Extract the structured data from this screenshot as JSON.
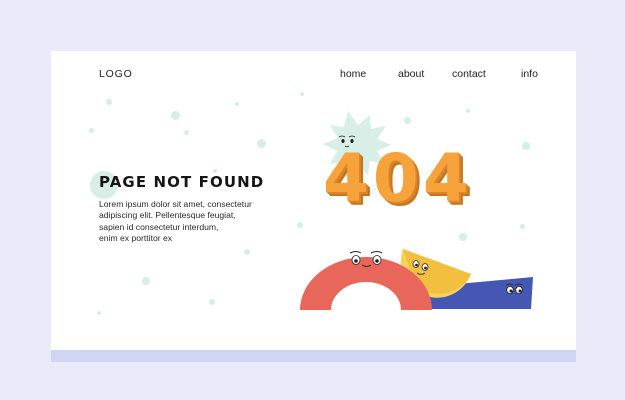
{
  "header": {
    "logo": "LOGO",
    "nav": [
      {
        "label": "home"
      },
      {
        "label": "about"
      },
      {
        "label": "contact"
      },
      {
        "label": "info"
      }
    ]
  },
  "hero": {
    "title": "PAGE NOT FOUND",
    "body_lines": [
      "Lorem ipsum dolor sit amet, consectetur",
      "adipiscing elit. Pellentesque feugiat,",
      "sapien id consectetur interdum,",
      "enim ex porttitor ex"
    ],
    "error_code": "404"
  },
  "colors": {
    "background": "#e9ebfb",
    "card": "#ffffff",
    "accent_orange": "#f5a33a",
    "shape_red": "#e8675a",
    "shape_yellow": "#f8d25a",
    "shape_blue": "#4556b3",
    "star_mint": "#d7efe6"
  },
  "icons": [
    "mint-star-character-icon",
    "red-arch-character-icon",
    "yellow-half-circle-character-icon",
    "blue-wedge-character-icon"
  ]
}
